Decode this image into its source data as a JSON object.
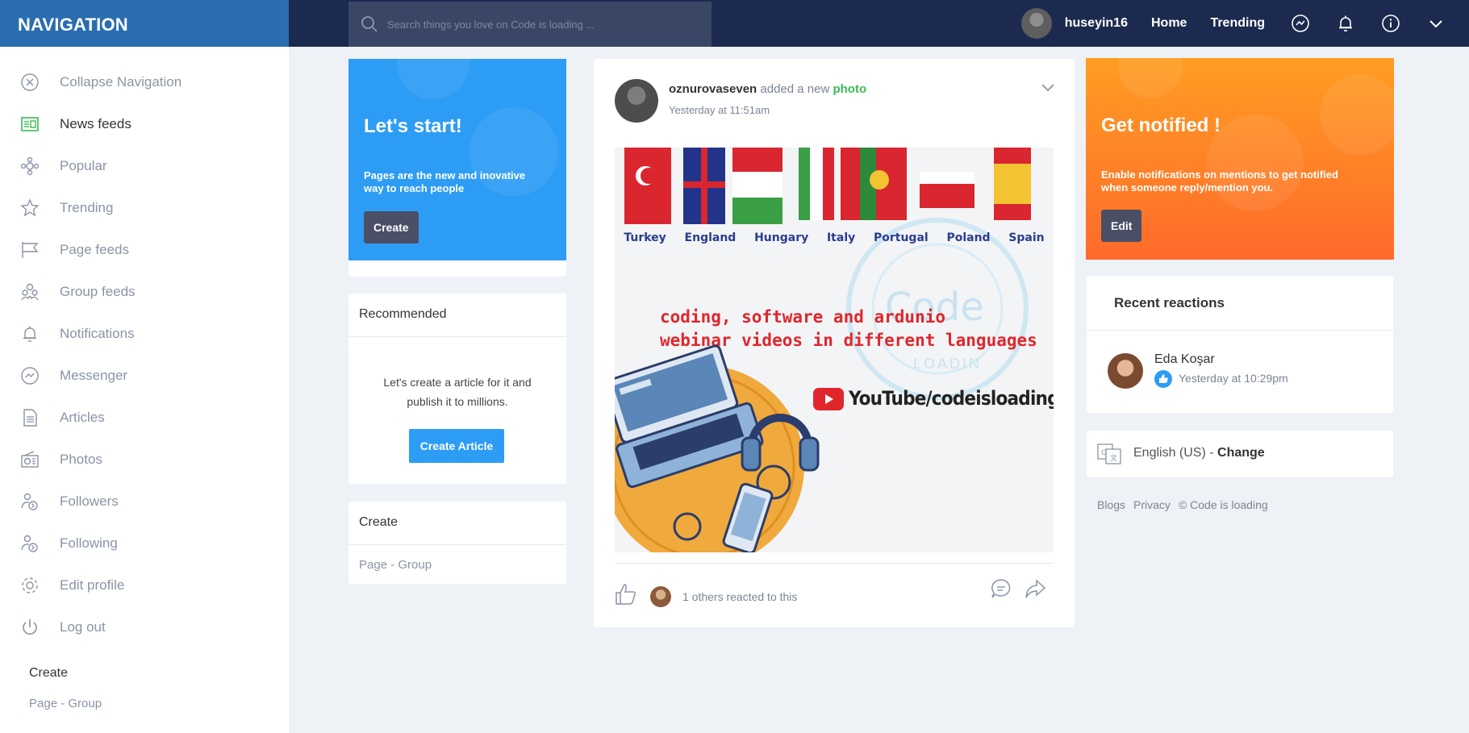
{
  "topbar": {
    "nav_title": "NAVIGATION",
    "search_placeholder": "Search things you love on Code is loading ...",
    "username": "huseyin16",
    "home_label": "Home",
    "trending_label": "Trending",
    "icons": [
      "messenger-icon",
      "bell-icon",
      "info-icon",
      "chevron-down-icon"
    ]
  },
  "sidebar": {
    "items": [
      {
        "label": "Collapse Navigation",
        "icon": "close-circle-icon"
      },
      {
        "label": "News feeds",
        "icon": "newspaper-icon"
      },
      {
        "label": "Popular",
        "icon": "popular-icon"
      },
      {
        "label": "Trending",
        "icon": "star-icon"
      },
      {
        "label": "Page feeds",
        "icon": "flag-icon"
      },
      {
        "label": "Group feeds",
        "icon": "group-icon"
      },
      {
        "label": "Notifications",
        "icon": "bell-icon"
      },
      {
        "label": "Messenger",
        "icon": "messenger-icon"
      },
      {
        "label": "Articles",
        "icon": "document-icon"
      },
      {
        "label": "Photos",
        "icon": "photo-icon"
      },
      {
        "label": "Followers",
        "icon": "followers-icon"
      },
      {
        "label": "Following",
        "icon": "following-icon"
      },
      {
        "label": "Edit profile",
        "icon": "gear-icon"
      },
      {
        "label": "Log out",
        "icon": "power-icon"
      }
    ],
    "create_title": "Create",
    "create_page": "Page",
    "create_sep": " - ",
    "create_group": "Group"
  },
  "promo_left": {
    "title": "Let's start!",
    "text": "Pages are the new and inovative way to reach people",
    "button": "Create"
  },
  "recommended": {
    "title": "Recommended",
    "text": "Let's create a article for it and publish it to millions.",
    "button": "Create Article"
  },
  "create_box": {
    "title": "Create",
    "page": "Page",
    "sep": " - ",
    "group": "Group"
  },
  "post": {
    "author": "oznurovaseven",
    "action": " added a new ",
    "object": "photo",
    "time": "Yesterday at 11:51am",
    "image": {
      "countries": [
        "Turkey",
        "England",
        "Hungary",
        "Italy",
        "Portugal",
        "Poland",
        "Spain"
      ],
      "headline_line1": "coding, software and ardunio",
      "headline_line2": "webinar videos in different languages",
      "youtube_label": "YouTube/codeisloading",
      "watermark": "Code",
      "watermark_sub": "LOADIN"
    },
    "reactions_text": "1 others reacted to this",
    "colors": {
      "photo_link": "#3cba54"
    }
  },
  "promo_right": {
    "title": "Get notified !",
    "text": "Enable notifications on mentions to get notified when someone reply/mention you.",
    "button": "Edit"
  },
  "recent_reactions": {
    "title": "Recent reactions",
    "name": "Eda Koşar",
    "time": "Yesterday at 10:29pm"
  },
  "language": {
    "label": "English (US)",
    "sep": " - ",
    "change": "Change"
  },
  "footer": {
    "blogs": "Blogs",
    "privacy": "Privacy",
    "copyright": "© Code is loading"
  }
}
